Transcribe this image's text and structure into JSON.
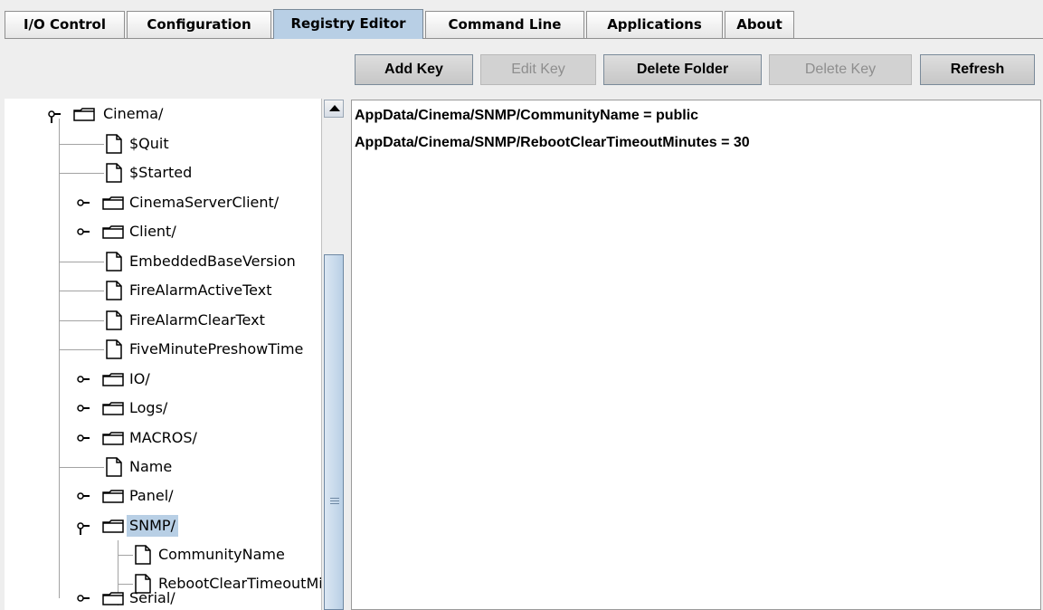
{
  "tabs": [
    {
      "label": "I/O Control",
      "active": false
    },
    {
      "label": "Configuration",
      "active": false
    },
    {
      "label": "Registry Editor",
      "active": true
    },
    {
      "label": "Command Line",
      "active": false
    },
    {
      "label": "Applications",
      "active": false
    },
    {
      "label": "About",
      "active": false
    }
  ],
  "toolbar": {
    "add_key": "Add Key",
    "edit_key": "Edit Key",
    "delete_folder": "Delete Folder",
    "delete_key": "Delete Key",
    "refresh": "Refresh"
  },
  "tree": {
    "nodes": [
      {
        "label": "Cinema/",
        "type": "folder",
        "expanded": true,
        "selected": false
      },
      {
        "label": "$Quit",
        "type": "file",
        "selected": false
      },
      {
        "label": "$Started",
        "type": "file",
        "selected": false
      },
      {
        "label": "CinemaServerClient/",
        "type": "folder",
        "expanded": false,
        "selected": false
      },
      {
        "label": "Client/",
        "type": "folder",
        "expanded": false,
        "selected": false
      },
      {
        "label": "EmbeddedBaseVersion",
        "type": "file",
        "selected": false
      },
      {
        "label": "FireAlarmActiveText",
        "type": "file",
        "selected": false
      },
      {
        "label": "FireAlarmClearText",
        "type": "file",
        "selected": false
      },
      {
        "label": "FiveMinutePreshowTime",
        "type": "file",
        "selected": false
      },
      {
        "label": "IO/",
        "type": "folder",
        "expanded": false,
        "selected": false
      },
      {
        "label": "Logs/",
        "type": "folder",
        "expanded": false,
        "selected": false
      },
      {
        "label": "MACROS/",
        "type": "folder",
        "expanded": false,
        "selected": false
      },
      {
        "label": "Name",
        "type": "file",
        "selected": false
      },
      {
        "label": "Panel/",
        "type": "folder",
        "expanded": false,
        "selected": false
      },
      {
        "label": "SNMP/",
        "type": "folder",
        "expanded": true,
        "selected": true
      },
      {
        "label": "CommunityName",
        "type": "file",
        "selected": false
      },
      {
        "label": "RebootClearTimeoutMinutes",
        "type": "file",
        "selected": false
      },
      {
        "label": "Serial/",
        "type": "folder",
        "expanded": false,
        "selected": false
      }
    ]
  },
  "registry_entries": [
    "AppData/Cinema/SNMP/CommunityName = public",
    "AppData/Cinema/SNMP/RebootClearTimeoutMinutes = 30"
  ],
  "colors": {
    "selection": "#b8cfe5",
    "active_tab": "#b8cfe5",
    "background": "#eeeeee",
    "disabled_text": "#8e8e8e"
  }
}
